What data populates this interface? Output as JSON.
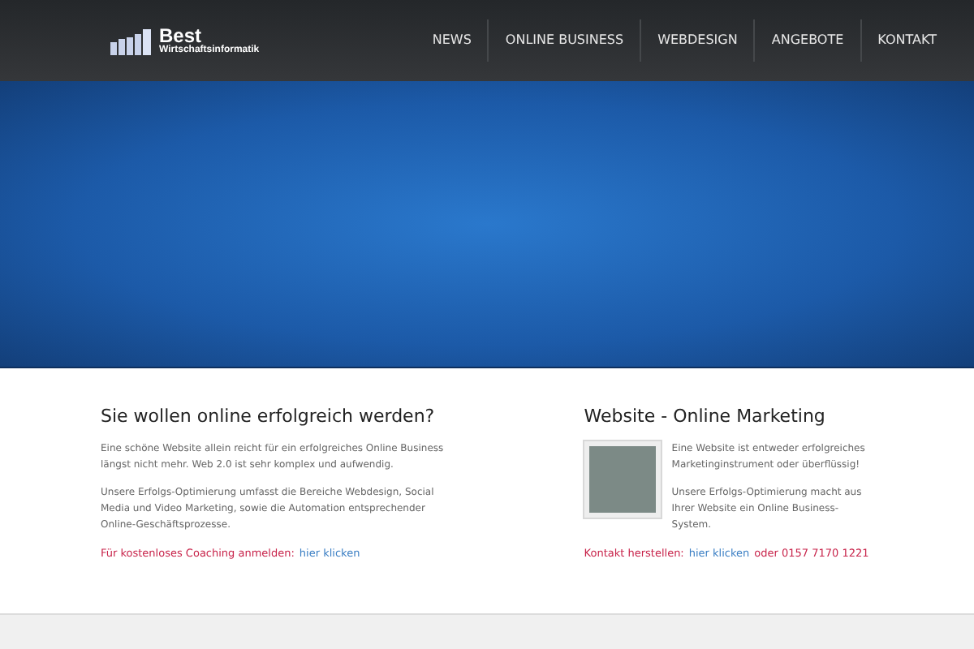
{
  "logo": {
    "title": "Best",
    "subtitle": "Wirtschaftsinformatik"
  },
  "nav": [
    "NEWS",
    "ONLINE BUSINESS",
    "WEBDESIGN",
    "ANGEBOTE",
    "KONTAKT"
  ],
  "left": {
    "heading": "Sie wollen online erfolgreich werden?",
    "paragraphs": [
      "Eine schöne Website allein reicht für ein erfolgreiches Online Business längst nicht mehr. Web 2.0 ist sehr komplex und aufwendig.",
      "Unsere Erfolgs-Optimierung umfasst die Bereiche Webdesign, Social Media und Video Marketing, sowie die Automation entsprechender Online-Geschäftsprozesse."
    ],
    "cta": {
      "prefix": "Für kostenloses Coaching anmelden:",
      "link": "hier klicken"
    }
  },
  "right": {
    "heading": "Website - Online Marketing",
    "paragraphs": [
      "Eine Website ist entweder erfolgreiches Marketinginstrument oder überflüssig!",
      "Unsere Erfolgs-Optimierung macht aus Ihrer Website ein Online Business-System."
    ],
    "cta": {
      "prefix": "Kontakt herstellen:",
      "link": "hier klicken",
      "suffix": "oder 0157 7170 1221"
    }
  }
}
